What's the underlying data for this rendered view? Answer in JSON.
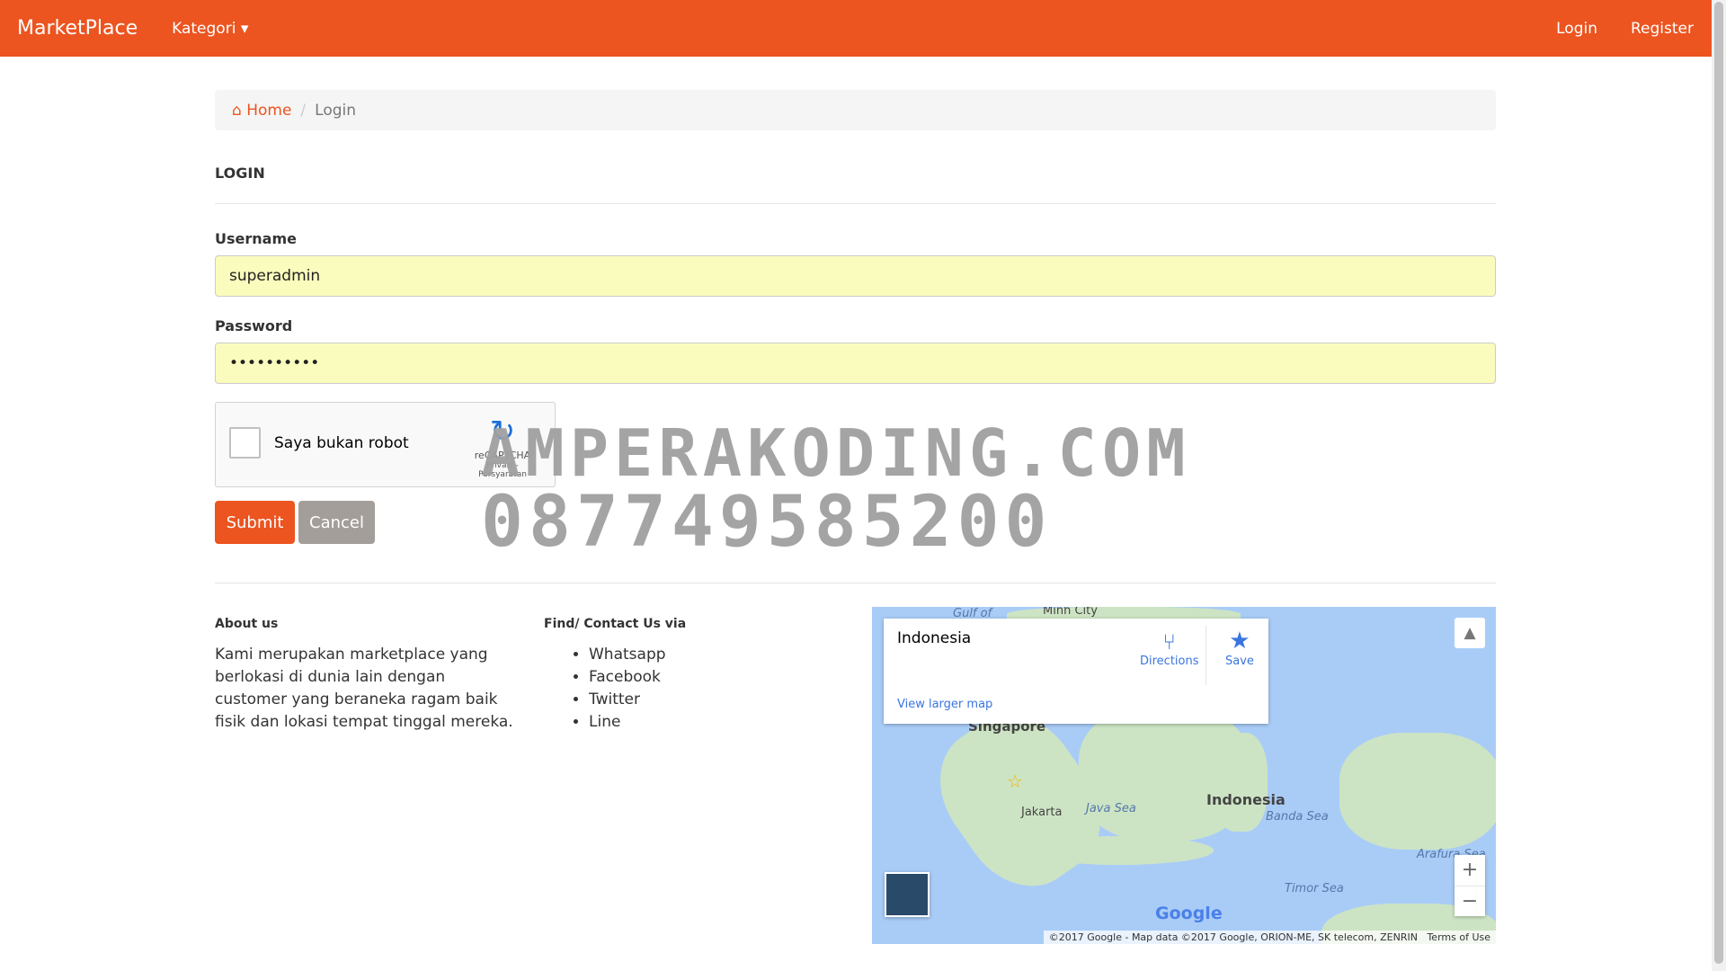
{
  "navbar": {
    "brand": "MarketPlace",
    "kategori": "Kategori ▾",
    "login": "Login",
    "register": "Register"
  },
  "breadcrumb": {
    "home": "Home",
    "current": "Login"
  },
  "form": {
    "title": "LOGIN",
    "username_label": "Username",
    "username_value": "superadmin",
    "password_label": "Password",
    "password_value": "••••••••••",
    "captcha_text": "Saya bukan robot",
    "captcha_brand": "reCAPTCHA",
    "captcha_links": "Privasi - Persyaratan",
    "submit": "Submit",
    "cancel": "Cancel"
  },
  "watermark": {
    "line1": "AMPERAKODING.COM",
    "line2": "087749585200"
  },
  "footer": {
    "about_title": "About us",
    "about_text": "Kami merupakan marketplace yang berlokasi di dunia lain dengan customer yang beraneka ragam baik fisik dan lokasi tempat tinggal mereka.",
    "contact_title": "Find/ Contact Us via",
    "contacts": [
      "Whatsapp",
      "Facebook",
      "Twitter",
      "Line"
    ]
  },
  "map": {
    "place": "Indonesia",
    "directions": "Directions",
    "save": "Save",
    "larger": "View larger map",
    "labels": [
      "Gulf of",
      "Minh City",
      "Singapore",
      "Jakarta",
      "Java Sea",
      "Indonesia",
      "Banda Sea",
      "Arafura Sea",
      "Timor Sea"
    ],
    "attribution": "©2017 Google - Map data ©2017 Google, ORION-ME, SK telecom, ZENRIN",
    "terms": "Terms of Use",
    "google": "Google"
  },
  "colors": {
    "accent": "#ec5420",
    "input_bg": "#fafcbd",
    "cancel": "#a39e99"
  }
}
